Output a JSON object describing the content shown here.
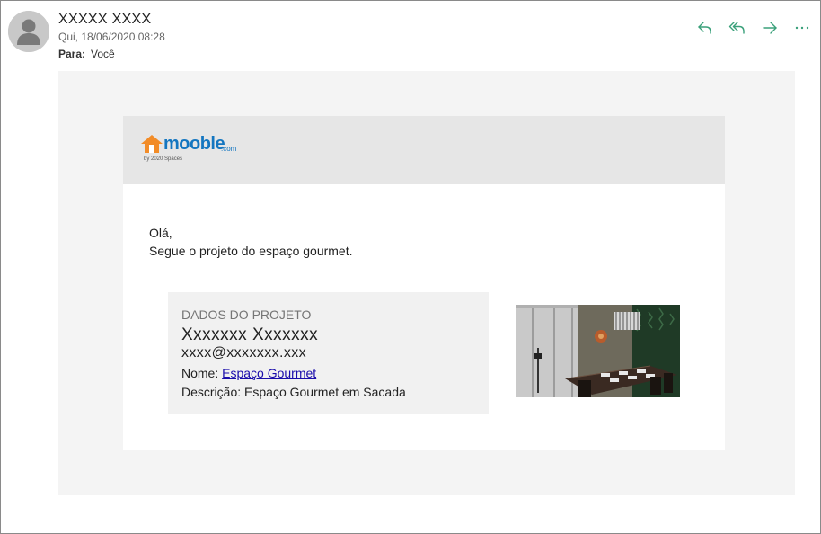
{
  "email": {
    "sender": "XXXXX XXXX",
    "date": "Qui, 18/06/2020 08:28",
    "to_label": "Para:",
    "to_value": "Você"
  },
  "toolbar": {
    "icons": [
      "reply-icon",
      "reply-all-icon",
      "forward-icon",
      "more-icon"
    ],
    "color": "#3aa07a"
  },
  "brand": {
    "name": "mooble",
    "suffix": ".com",
    "tagline": "by 2020 Spaces",
    "color": "#1476c0",
    "house_color": "#f28c28"
  },
  "body": {
    "greeting": "Olá,",
    "message": "Segue o projeto do espaço gourmet."
  },
  "project": {
    "heading": "DADOS DO PROJETO",
    "client_name": "Xxxxxxx Xxxxxxx",
    "client_email": "xxxx@xxxxxxx.xxx",
    "name_label": "Nome: ",
    "name_value": "Espaço Gourmet",
    "description_label": "Descrição: ",
    "description_value": "Espaço Gourmet em Sacada"
  }
}
